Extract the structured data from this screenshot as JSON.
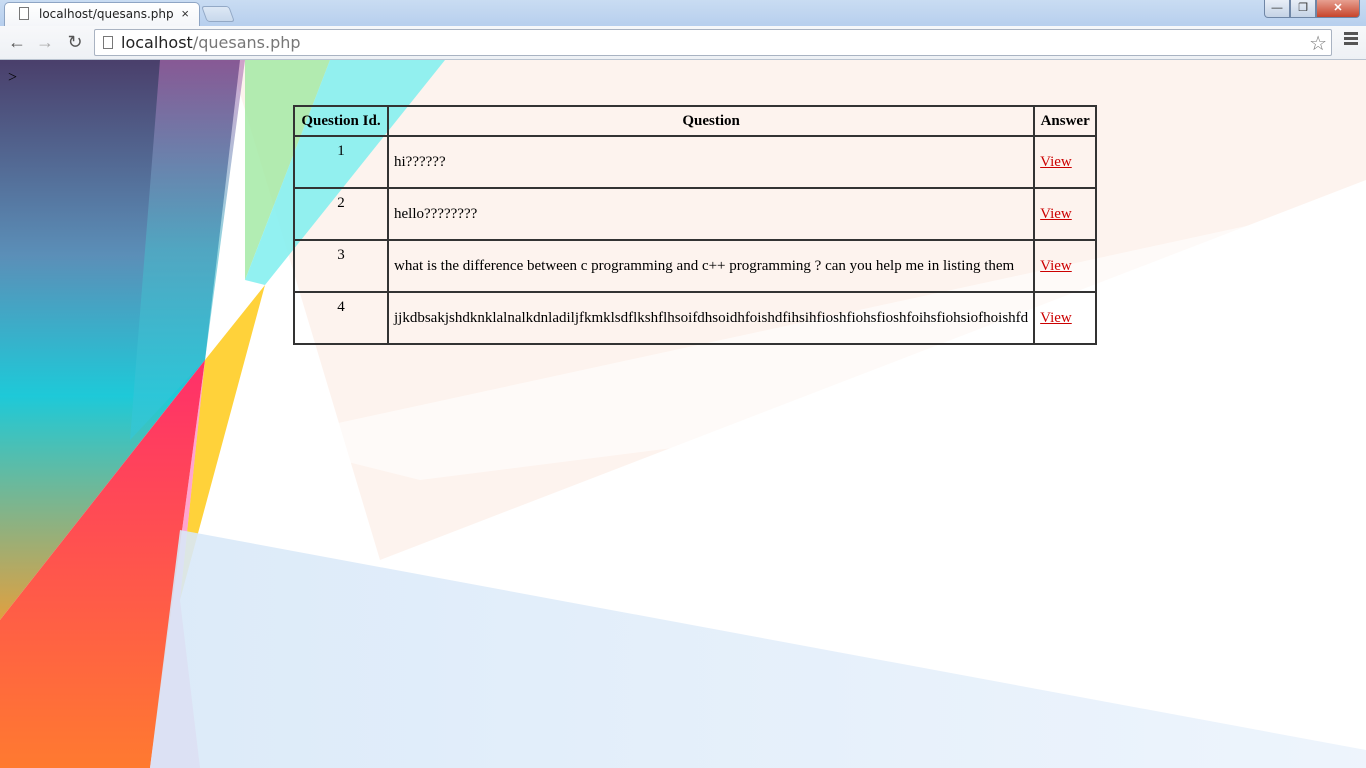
{
  "browser": {
    "tab_title": "localhost/quesans.php",
    "tab_close": "×",
    "url_host": "localhost",
    "url_path": "/quesans.php"
  },
  "page": {
    "stray_text": ">",
    "table": {
      "headers": [
        "Question Id.",
        "Question",
        "Answer"
      ],
      "rows": [
        {
          "id": "1",
          "question": "hi??????",
          "answer": "View"
        },
        {
          "id": "2",
          "question": "hello????????",
          "answer": "View"
        },
        {
          "id": "3",
          "question": "what is the difference between c programming and c++ programming ? can you help me in listing them",
          "answer": "View"
        },
        {
          "id": "4",
          "question": "jjkdbsakjshdknklalnalkdnladiljfkmklsdflkshflhsoifdhsoidhfoishdfihsihfioshfiohsfioshfoihsfiohsiofhoishfd",
          "answer": "View"
        }
      ]
    }
  },
  "colors": {
    "link": "#cc0000",
    "table_border": "#333333"
  }
}
